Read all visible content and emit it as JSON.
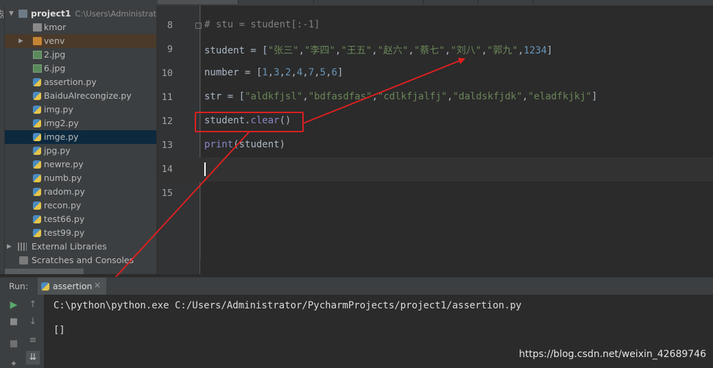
{
  "project": {
    "root_name": "project1",
    "root_path": "C:\\Users\\Administrato",
    "items": [
      {
        "label": "kmor",
        "kind": "folder"
      },
      {
        "label": "venv",
        "kind": "folder-excluded"
      },
      {
        "label": "2.jpg",
        "kind": "image"
      },
      {
        "label": "6.jpg",
        "kind": "image"
      },
      {
        "label": "assertion.py",
        "kind": "python"
      },
      {
        "label": "BaiduAIrecongize.py",
        "kind": "python"
      },
      {
        "label": "img.py",
        "kind": "python"
      },
      {
        "label": "img2.py",
        "kind": "python"
      },
      {
        "label": "imge.py",
        "kind": "python",
        "selected": true
      },
      {
        "label": "jpg.py",
        "kind": "python"
      },
      {
        "label": "newre.py",
        "kind": "python"
      },
      {
        "label": "numb.py",
        "kind": "python"
      },
      {
        "label": "radom.py",
        "kind": "python"
      },
      {
        "label": "recon.py",
        "kind": "python"
      },
      {
        "label": "test66.py",
        "kind": "python"
      },
      {
        "label": "test99.py",
        "kind": "python"
      }
    ],
    "external_libraries": "External Libraries",
    "scratches": "Scratches and Consoles"
  },
  "editor": {
    "lines": [
      {
        "no": "8",
        "parts": [
          [
            "cmt",
            "# stu = student[:-1]"
          ]
        ]
      },
      {
        "no": "9",
        "parts": [
          [
            "t",
            "student = ["
          ],
          [
            "str",
            "\"张三\""
          ],
          [
            "t",
            ","
          ],
          [
            "str",
            "\"李四\""
          ],
          [
            "t",
            ","
          ],
          [
            "str",
            "\"王五\""
          ],
          [
            "t",
            ","
          ],
          [
            "str",
            "\"赵六\""
          ],
          [
            "t",
            ","
          ],
          [
            "str",
            "\"蔡七\""
          ],
          [
            "t",
            ","
          ],
          [
            "str",
            "\"刘八\""
          ],
          [
            "t",
            ","
          ],
          [
            "str",
            "\"郭九\""
          ],
          [
            "t",
            ","
          ],
          [
            "num",
            "1234"
          ],
          [
            "t",
            "]"
          ]
        ]
      },
      {
        "no": "10",
        "parts": [
          [
            "t",
            "number = ["
          ],
          [
            "num",
            "1"
          ],
          [
            "t",
            ","
          ],
          [
            "num",
            "3"
          ],
          [
            "t",
            ","
          ],
          [
            "num",
            "2"
          ],
          [
            "t",
            ","
          ],
          [
            "num",
            "4"
          ],
          [
            "t",
            ","
          ],
          [
            "num",
            "7"
          ],
          [
            "t",
            ","
          ],
          [
            "num",
            "5"
          ],
          [
            "t",
            ","
          ],
          [
            "num",
            "6"
          ],
          [
            "t",
            "]"
          ]
        ]
      },
      {
        "no": "11",
        "parts": [
          [
            "t",
            "str = ["
          ],
          [
            "str",
            "\"aldkfjsl\""
          ],
          [
            "t",
            ","
          ],
          [
            "str",
            "\"bdfasdfas\""
          ],
          [
            "t",
            ","
          ],
          [
            "str",
            "\"cdlkfjalfj\""
          ],
          [
            "t",
            ","
          ],
          [
            "str",
            "\"daldskfjdk\""
          ],
          [
            "t",
            ","
          ],
          [
            "str",
            "\"eladfkjkj\""
          ],
          [
            "t",
            "]"
          ]
        ]
      },
      {
        "no": "12",
        "parts": [
          [
            "t",
            "student."
          ],
          [
            "meth",
            "clear"
          ],
          [
            "t",
            "()"
          ]
        ]
      },
      {
        "no": "13",
        "parts": [
          [
            "fn",
            "print"
          ],
          [
            "t",
            "(student)"
          ]
        ]
      },
      {
        "no": "14",
        "parts": [],
        "current": true
      },
      {
        "no": "15",
        "parts": []
      }
    ]
  },
  "run": {
    "label": "Run:",
    "tab_label": "assertion",
    "close": "×"
  },
  "console": {
    "command": "C:\\python\\python.exe C:/Users/Administrator/PycharmProjects/project1/assertion.py",
    "output": "[]"
  },
  "watermark": "https://blog.csdn.net/weixin_42689746",
  "left_strip_text": "Str",
  "colors": {
    "annotation": "#e02020"
  }
}
